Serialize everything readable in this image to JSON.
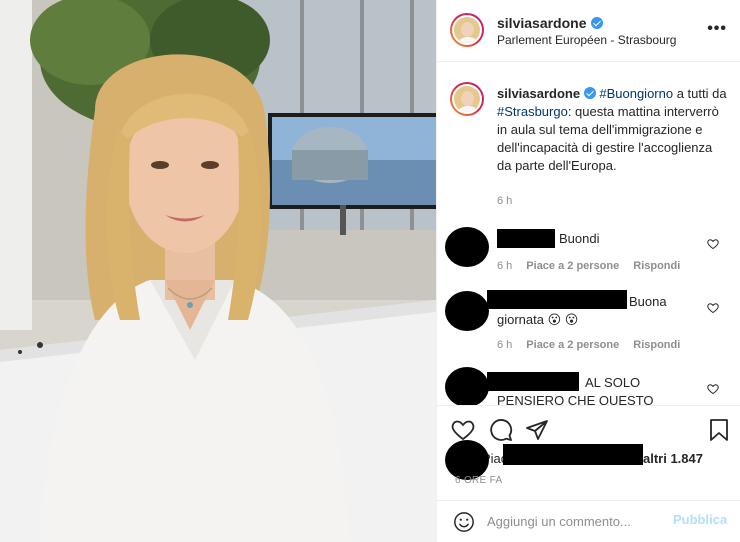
{
  "post": {
    "username": "silviasardone",
    "location": "Parlement Européen - Strasbourg",
    "more_icon": "more-horizontal-icon"
  },
  "caption": {
    "username": "silviasardone",
    "hashtag1": "#Buongiorno",
    "text1": " a tutti da ",
    "hashtag2": "#Strasburgo",
    "text2": ": questa mattina interverrò in aula sul tema dell'immigrazione e dell'incapacità di gestire l'accoglienza da parte dell'Europa.",
    "time": "6 h"
  },
  "comments": [
    {
      "text": "Buondi",
      "time": "6 h",
      "likes": "Piace a 2 persone",
      "reply": "Rispondi"
    },
    {
      "text_line1": "Buona",
      "text_line2": "giornata 😮 😮",
      "time": "6 h",
      "likes": "Piace a 2 persone",
      "reply": "Rispondi"
    },
    {
      "text_line1": "AL SOLO",
      "text_line2": "PENSIERO CHE QUESTO"
    }
  ],
  "actions": {
    "like_icon": "heart-icon",
    "comment_icon": "comment-icon",
    "share_icon": "paper-plane-icon",
    "save_icon": "bookmark-icon",
    "likes_prefix": "Piace",
    "likes_suffix": "altri 1.847",
    "post_time": "6 ORE FA"
  },
  "add_comment": {
    "emoji_icon": "smiley-icon",
    "placeholder": "Aggiungi un commento...",
    "publish_label": "Pubblica"
  },
  "colors": {
    "link": "#00376b",
    "verified": "#3897f0",
    "muted": "#8e8e8e",
    "publish_disabled": "#b2dffc"
  }
}
